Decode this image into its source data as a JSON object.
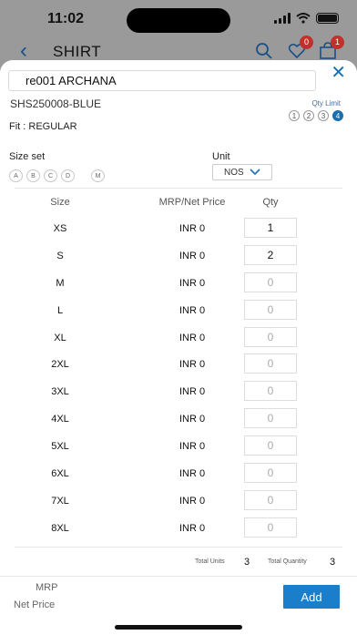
{
  "status": {
    "time": "11:02"
  },
  "app_header": {
    "title": "SHIRT",
    "wishlist_count": "0",
    "cart_count": "1"
  },
  "modal": {
    "item_name": "re001 ARCHANA",
    "sku": "SHS250008-BLUE",
    "qty_limit_label": "Qty Limit",
    "qty_limit_options": [
      "1",
      "2",
      "3",
      "4"
    ],
    "qty_limit_selected": "4",
    "fit_label": "Fit : REGULAR",
    "size_set_label": "Size set",
    "size_set_options": [
      "A",
      "B",
      "C",
      "D",
      "M"
    ],
    "unit_label": "Unit",
    "unit_value": "NOS",
    "table": {
      "headers": {
        "size": "Size",
        "price": "MRP/Net Price",
        "qty": "Qty"
      },
      "rows": [
        {
          "size": "XS",
          "price": "INR 0",
          "qty": "1"
        },
        {
          "size": "S",
          "price": "INR 0",
          "qty": "2"
        },
        {
          "size": "M",
          "price": "INR 0",
          "qty": "0"
        },
        {
          "size": "L",
          "price": "INR 0",
          "qty": "0"
        },
        {
          "size": "XL",
          "price": "INR 0",
          "qty": "0"
        },
        {
          "size": "2XL",
          "price": "INR 0",
          "qty": "0"
        },
        {
          "size": "3XL",
          "price": "INR 0",
          "qty": "0"
        },
        {
          "size": "4XL",
          "price": "INR 0",
          "qty": "0"
        },
        {
          "size": "5XL",
          "price": "INR 0",
          "qty": "0"
        },
        {
          "size": "6XL",
          "price": "INR 0",
          "qty": "0"
        },
        {
          "size": "7XL",
          "price": "INR 0",
          "qty": "0"
        },
        {
          "size": "8XL",
          "price": "INR 0",
          "qty": "0"
        }
      ]
    },
    "totals": {
      "units_label": "Total Units",
      "units_value": "3",
      "quantity_label": "Total Quantity",
      "quantity_value": "3"
    },
    "footer": {
      "mrp_label": "MRP",
      "net_price_label": "Net Price",
      "add_label": "Add"
    }
  },
  "colors": {
    "accent": "#1a7ecb",
    "badge": "#c2302c"
  }
}
